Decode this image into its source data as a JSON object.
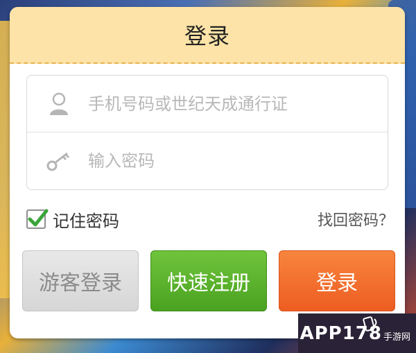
{
  "dialog": {
    "title": "登录"
  },
  "form": {
    "account_placeholder": "手机号码或世纪天成通行证",
    "password_placeholder": "输入密码"
  },
  "options": {
    "remember_label": "记住密码",
    "remember_checked": true,
    "forgot_label": "找回密码？"
  },
  "buttons": {
    "guest_label": "游客登录",
    "register_label": "快速注册",
    "login_label": "登录"
  },
  "watermark": {
    "brand": "APP178",
    "sub": "手游网"
  },
  "colors": {
    "header_bg": "#fde3a7",
    "register_green": "#4aa221",
    "login_orange": "#ee5d22",
    "check_green": "#3aa53a"
  },
  "icons": {
    "account": "user-icon",
    "password": "key-icon",
    "checkbox": "checkmark-icon"
  }
}
